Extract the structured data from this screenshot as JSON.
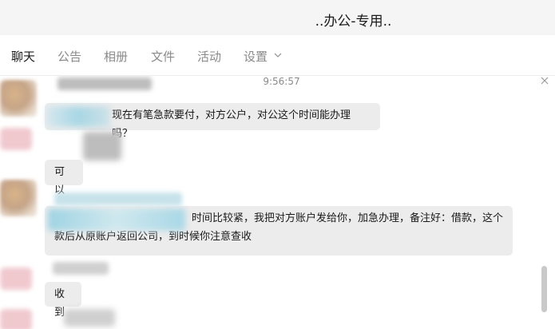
{
  "window": {
    "title": "..办公-专用.."
  },
  "tabs": [
    {
      "label": "聊天",
      "active": true
    },
    {
      "label": "公告",
      "active": false
    },
    {
      "label": "相册",
      "active": false
    },
    {
      "label": "文件",
      "active": false
    },
    {
      "label": "活动",
      "active": false
    },
    {
      "label": "设置",
      "active": false,
      "has_dropdown": true
    }
  ],
  "chat": {
    "timestamp": "9:56:57",
    "messages": [
      {
        "text": "现在有笔急款要付，对方公户，对公这个时间能办理吗？",
        "sender_name_obscured": true
      },
      {
        "text": "可以",
        "sender_name_obscured": true
      },
      {
        "line1": "时间比较紧，我把对方账户发给你，加急办理，备注好：借款，这个",
        "line2": "款后从原账户返回公司，到时候你注意查收",
        "sender_name_obscured": true
      },
      {
        "text": "收到",
        "sender_name_obscured": true
      }
    ]
  },
  "icons": {
    "phone": "phone-icon",
    "dropdown": "chevron-down-icon",
    "close": "close-icon"
  },
  "colors": {
    "bubble": "#ececec",
    "active_tab": "#1a1a1a",
    "inactive_tab": "#8a8a8a"
  }
}
